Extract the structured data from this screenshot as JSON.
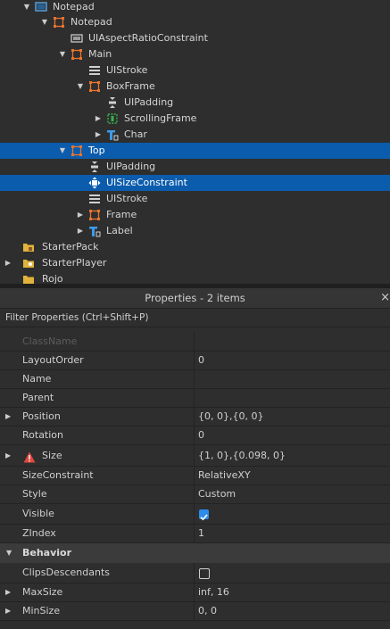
{
  "explorer": {
    "items": [
      {
        "label": "Notepad",
        "icon": "screen-gui-icon",
        "indent": 0,
        "expanded": true
      },
      {
        "label": "Notepad",
        "icon": "frame-icon",
        "indent": 1,
        "expanded": true
      },
      {
        "label": "UIAspectRatioConstraint",
        "icon": "aspect-ratio-icon",
        "indent": 2,
        "expanded": null
      },
      {
        "label": "Main",
        "icon": "frame-icon",
        "indent": 2,
        "expanded": true
      },
      {
        "label": "UIStroke",
        "icon": "stroke-icon",
        "indent": 3,
        "expanded": null
      },
      {
        "label": "BoxFrame",
        "icon": "frame-icon",
        "indent": 3,
        "expanded": true
      },
      {
        "label": "UIPadding",
        "icon": "padding-icon",
        "indent": 4,
        "expanded": null
      },
      {
        "label": "ScrollingFrame",
        "icon": "scrolling-frame-icon",
        "indent": 4,
        "expanded": false
      },
      {
        "label": "Char",
        "icon": "text-label-icon",
        "indent": 4,
        "expanded": false
      },
      {
        "label": "Top",
        "icon": "frame-icon",
        "indent": 2,
        "expanded": true,
        "selected": true
      },
      {
        "label": "UIPadding",
        "icon": "padding-icon",
        "indent": 3,
        "expanded": null
      },
      {
        "label": "UISizeConstraint",
        "icon": "size-constraint-icon",
        "indent": 3,
        "expanded": null,
        "selected": true
      },
      {
        "label": "UIStroke",
        "icon": "stroke-icon",
        "indent": 3,
        "expanded": null
      },
      {
        "label": "Frame",
        "icon": "frame-icon",
        "indent": 3,
        "expanded": false
      },
      {
        "label": "Label",
        "icon": "text-label-icon",
        "indent": 3,
        "expanded": false
      },
      {
        "label": "StarterPack",
        "icon": "starter-pack-icon",
        "indent": 0,
        "expanded": null
      },
      {
        "label": "StarterPlayer",
        "icon": "starter-player-icon",
        "indent": 0,
        "expanded": false
      },
      {
        "label": "Rojo",
        "icon": "folder-icon",
        "indent": 0,
        "expanded": null
      }
    ]
  },
  "properties": {
    "title": "Properties - 2 items",
    "close_label": "×",
    "filter_placeholder": "Filter Properties (Ctrl+Shift+P)",
    "rows": [
      {
        "name": "ClassName",
        "value": "",
        "dim": true
      },
      {
        "name": "LayoutOrder",
        "value": "0"
      },
      {
        "name": "Name",
        "value": ""
      },
      {
        "name": "Parent",
        "value": ""
      },
      {
        "name": "Position",
        "value": "{0, 0},{0, 0}",
        "expandable": true
      },
      {
        "name": "Rotation",
        "value": "0"
      },
      {
        "name": "Size",
        "value": "{1, 0},{0.098, 0}",
        "expandable": true,
        "warning": true
      },
      {
        "name": "SizeConstraint",
        "value": "RelativeXY"
      },
      {
        "name": "Style",
        "value": "Custom"
      },
      {
        "name": "Visible",
        "value": "",
        "checkbox": true,
        "checked": true
      },
      {
        "name": "ZIndex",
        "value": "1"
      },
      {
        "section": true,
        "name": "Behavior"
      },
      {
        "name": "ClipsDescendants",
        "value": "",
        "checkbox": true,
        "checked": false
      },
      {
        "name": "MaxSize",
        "value": "inf, 16",
        "expandable": true
      },
      {
        "name": "MinSize",
        "value": "0, 0",
        "expandable": true
      }
    ]
  },
  "colors": {
    "selection": "#0b5cad",
    "frame_icon": "#e8742e",
    "text_icon": "#3d9be9",
    "scroll_icon": "#37b24d",
    "checkbox_on": "#2d8ceb",
    "warning": "#e0473d"
  }
}
